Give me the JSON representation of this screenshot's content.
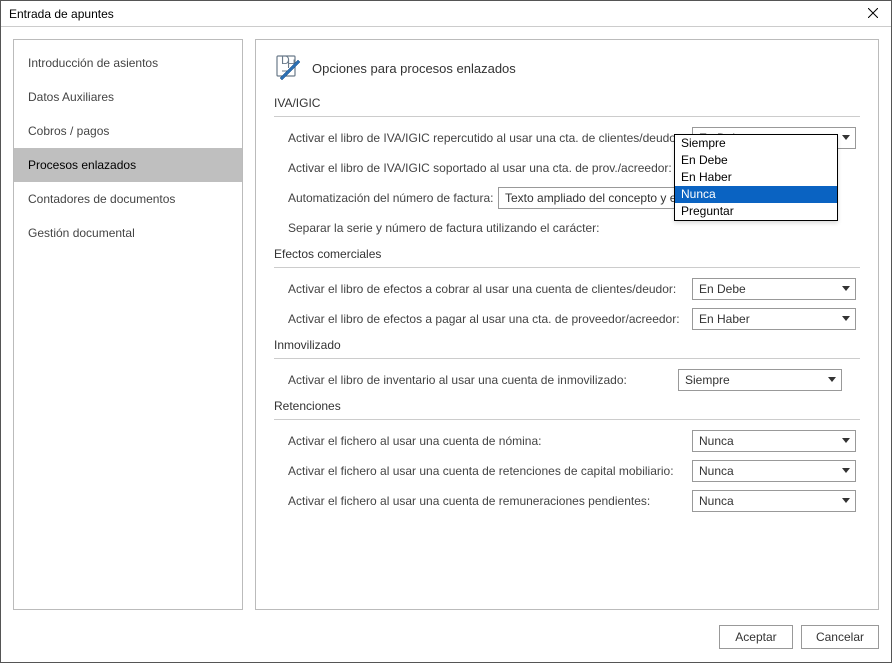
{
  "window": {
    "title": "Entrada de apuntes"
  },
  "sidebar": {
    "items": [
      {
        "label": "Introducción de asientos"
      },
      {
        "label": "Datos Auxiliares"
      },
      {
        "label": "Cobros / pagos"
      },
      {
        "label": "Procesos enlazados"
      },
      {
        "label": "Contadores de documentos"
      },
      {
        "label": "Gestión documental"
      }
    ],
    "selectedIndex": 3
  },
  "page": {
    "title": "Opciones para procesos enlazados"
  },
  "sections": {
    "iva": {
      "title": "IVA/IGIC",
      "row1": {
        "label": "Activar el libro de IVA/IGIC repercutido al usar una cta. de clientes/deudor:",
        "value": "En Debe"
      },
      "row2": {
        "label": "Activar el libro de IVA/IGIC soportado al usar una cta. de prov./acreedor:"
      },
      "row3": {
        "label": "Automatización del número de factura:",
        "value": "Texto ampliado del concepto y en"
      },
      "row4": {
        "label": "Separar la serie y número de factura utilizando el carácter:"
      },
      "dropdown": {
        "items": [
          {
            "label": "Siempre"
          },
          {
            "label": "En Debe"
          },
          {
            "label": "En Haber"
          },
          {
            "label": "Nunca"
          },
          {
            "label": "Preguntar"
          }
        ],
        "highlightIndex": 3
      }
    },
    "efectos": {
      "title": "Efectos comerciales",
      "row1": {
        "label": "Activar el libro de efectos a cobrar al usar una cuenta de clientes/deudor:",
        "value": "En Debe"
      },
      "row2": {
        "label": "Activar el libro de efectos a pagar al usar una cta. de proveedor/acreedor:",
        "value": "En Haber"
      }
    },
    "inmov": {
      "title": "Inmovilizado",
      "row1": {
        "label": "Activar el libro de inventario al usar una cuenta de inmovilizado:",
        "value": "Siempre"
      }
    },
    "reten": {
      "title": "Retenciones",
      "row1": {
        "label": "Activar el fichero al usar una cuenta de nómina:",
        "value": "Nunca"
      },
      "row2": {
        "label": "Activar el fichero al usar una cuenta de retenciones de capital mobiliario:",
        "value": "Nunca"
      },
      "row3": {
        "label": "Activar el fichero al usar una cuenta de remuneraciones pendientes:",
        "value": "Nunca"
      }
    }
  },
  "footer": {
    "accept": "Aceptar",
    "cancel": "Cancelar"
  }
}
